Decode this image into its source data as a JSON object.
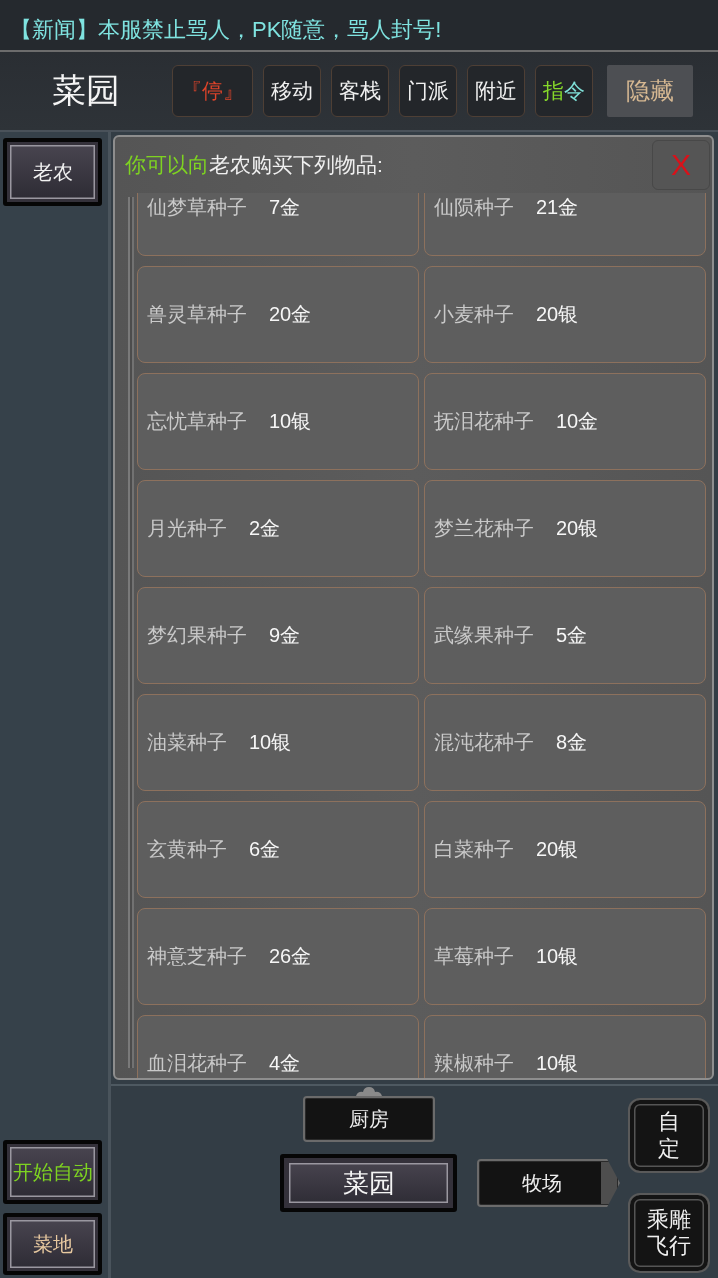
{
  "news": {
    "text": "【新闻】本服禁止骂人，PK随意，骂人封号!"
  },
  "header": {
    "title": "菜园",
    "buttons": [
      {
        "label": "『停』",
        "kind": "stop"
      },
      {
        "label": "移动",
        "kind": "normal"
      },
      {
        "label": "客栈",
        "kind": "normal"
      },
      {
        "label": "门派",
        "kind": "normal"
      },
      {
        "label": "附近",
        "kind": "normal"
      },
      {
        "label": "**指**令",
        "kind": "command"
      },
      {
        "label": "隐藏",
        "kind": "hide"
      }
    ]
  },
  "sidebar": {
    "top": [
      {
        "label": "老农",
        "kind": "npc"
      }
    ],
    "bottom": [
      {
        "label": "开始自动",
        "kind": "auto"
      },
      {
        "label": "菜地",
        "kind": "place"
      }
    ]
  },
  "shop": {
    "prompt": "**你可以向**老农购买下列物品:",
    "close": "X",
    "items": [
      {
        "name": "仙梦草种子",
        "price": "7金"
      },
      {
        "name": "仙陨种子",
        "price": "21金"
      },
      {
        "name": "兽灵草种子",
        "price": "20金"
      },
      {
        "name": "小麦种子",
        "price": "20银"
      },
      {
        "name": "忘忧草种子",
        "price": "10银"
      },
      {
        "name": "抚泪花种子",
        "price": "10金"
      },
      {
        "name": "月光种子",
        "price": "2金"
      },
      {
        "name": "梦兰花种子",
        "price": "20银"
      },
      {
        "name": "梦幻果种子",
        "price": "9金"
      },
      {
        "name": "武缘果种子",
        "price": "5金"
      },
      {
        "name": "油菜种子",
        "price": "10银"
      },
      {
        "name": "混沌花种子",
        "price": "8金"
      },
      {
        "name": "玄黄种子",
        "price": "6金"
      },
      {
        "name": "白菜种子",
        "price": "20银"
      },
      {
        "name": "神意芝种子",
        "price": "26金"
      },
      {
        "name": "草莓种子",
        "price": "10银"
      },
      {
        "name": "血泪花种子",
        "price": "4金"
      },
      {
        "name": "辣椒种子",
        "price": "10银"
      }
    ]
  },
  "map": {
    "nodes": [
      {
        "label": "厨房",
        "kind": "north",
        "selected": false
      },
      {
        "label": "菜园",
        "kind": "center",
        "selected": true
      },
      {
        "label": "牧场",
        "kind": "east",
        "selected": false
      }
    ]
  },
  "side_actions": [
    {
      "label": "自定",
      "kind": "column"
    },
    {
      "label": "乘雕飞行",
      "kind": "block"
    }
  ]
}
